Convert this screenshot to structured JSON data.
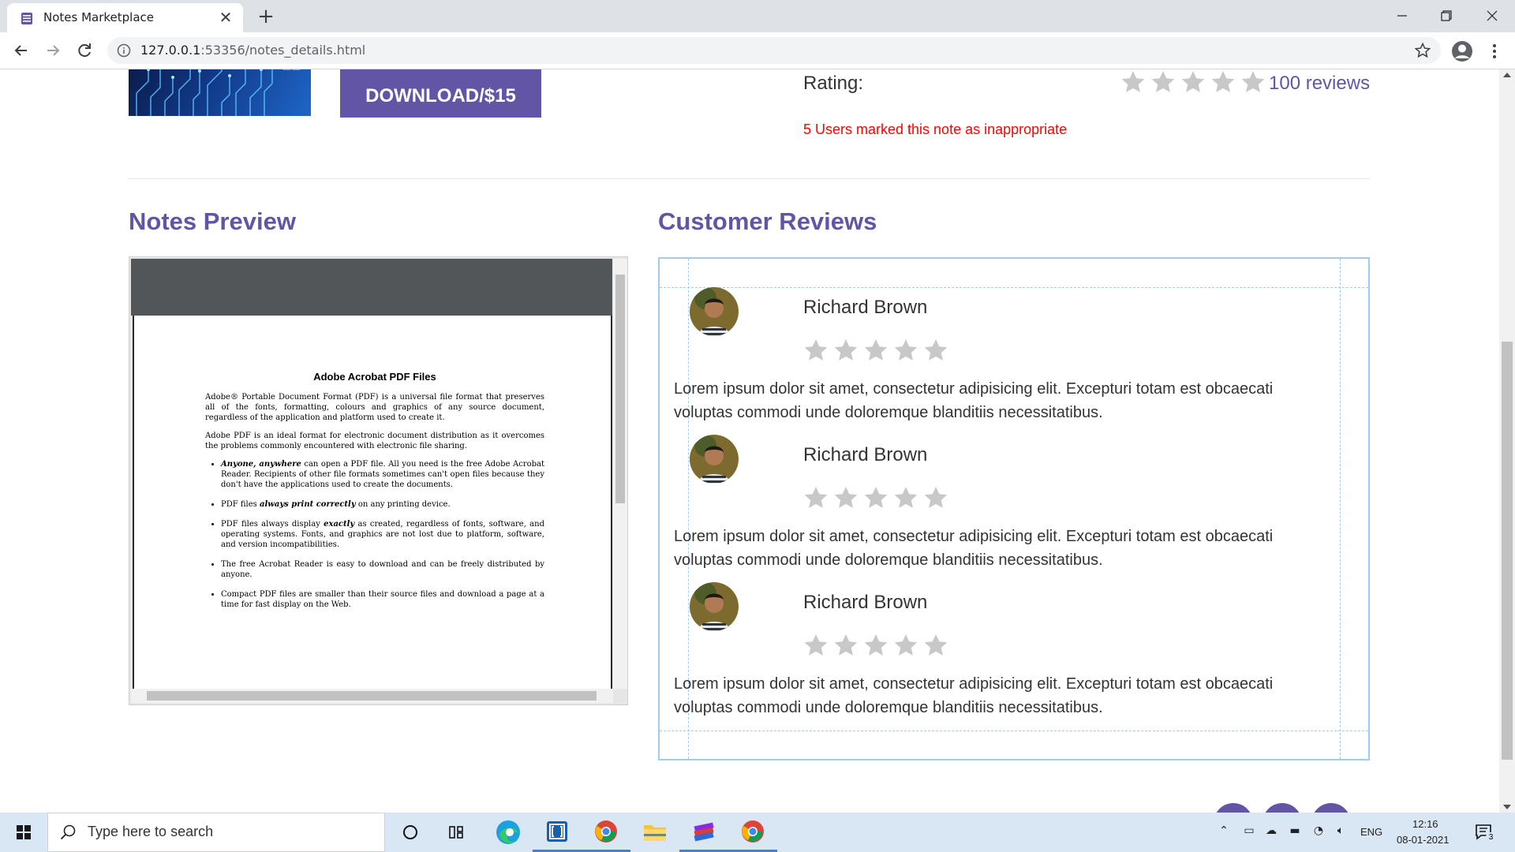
{
  "browser": {
    "tab_title": "Notes Marketplace",
    "url_host": "127.0.0.1",
    "url_path": ":53356/notes_details.html"
  },
  "note": {
    "download_label": "DOWNLOAD/$15",
    "rating_label": "Rating:",
    "rating_stars": 5,
    "reviews_count": "100 reviews",
    "inappropriate_text": "5 Users marked this note as inappropriate"
  },
  "sections": {
    "preview_title": "Notes Preview",
    "reviews_title": "Customer Reviews"
  },
  "pdf": {
    "heading": "Adobe Acrobat PDF Files",
    "para1": "Adobe® Portable Document Format (PDF) is a universal file format that preserves all of the fonts, formatting, colours and graphics of any source document, regardless of the application and platform used to create it.",
    "para2": "Adobe PDF is an ideal format for electronic document distribution as it overcomes the problems commonly encountered with electronic file sharing.",
    "bullets": [
      {
        "em": "Anyone, anywhere",
        "rest": " can open a PDF file. All you need is the free Adobe Acrobat Reader. Recipients of other file formats sometimes can't open files because they don't have the applications used to create the documents."
      },
      {
        "pre": "PDF files ",
        "em": "always print correctly",
        "rest": " on any printing device."
      },
      {
        "pre": "PDF files always display ",
        "em": "exactly",
        "rest": " as created, regardless of fonts, software, and operating systems. Fonts, and graphics are not lost due to platform, software, and version incompatibilities."
      },
      {
        "rest": "The free Acrobat Reader is easy to download and can be freely distributed by anyone."
      },
      {
        "rest": "Compact PDF files are smaller than their source files and download a page at a time for fast display on the Web."
      }
    ]
  },
  "reviews": [
    {
      "name": "Richard Brown",
      "stars": 5,
      "text": "Lorem ipsum dolor sit amet, consectetur adipisicing elit. Excepturi totam est obcaecati voluptas commodi unde doloremque blanditiis necessitatibus."
    },
    {
      "name": "Richard Brown",
      "stars": 5,
      "text": "Lorem ipsum dolor sit amet, consectetur adipisicing elit. Excepturi totam est obcaecati voluptas commodi unde doloremque blanditiis necessitatibus."
    },
    {
      "name": "Richard Brown",
      "stars": 5,
      "text": "Lorem ipsum dolor sit amet, consectetur adipisicing elit. Excepturi totam est obcaecati voluptas commodi unde doloremque blanditiis necessitatibus."
    }
  ],
  "taskbar": {
    "search_placeholder": "Type here to search",
    "language": "ENG",
    "time": "12:16",
    "date": "08-01-2021",
    "notification_count": "3"
  },
  "colors": {
    "brand": "#6255a5",
    "alert": "#ff0000",
    "star": "#c8c8c8"
  }
}
